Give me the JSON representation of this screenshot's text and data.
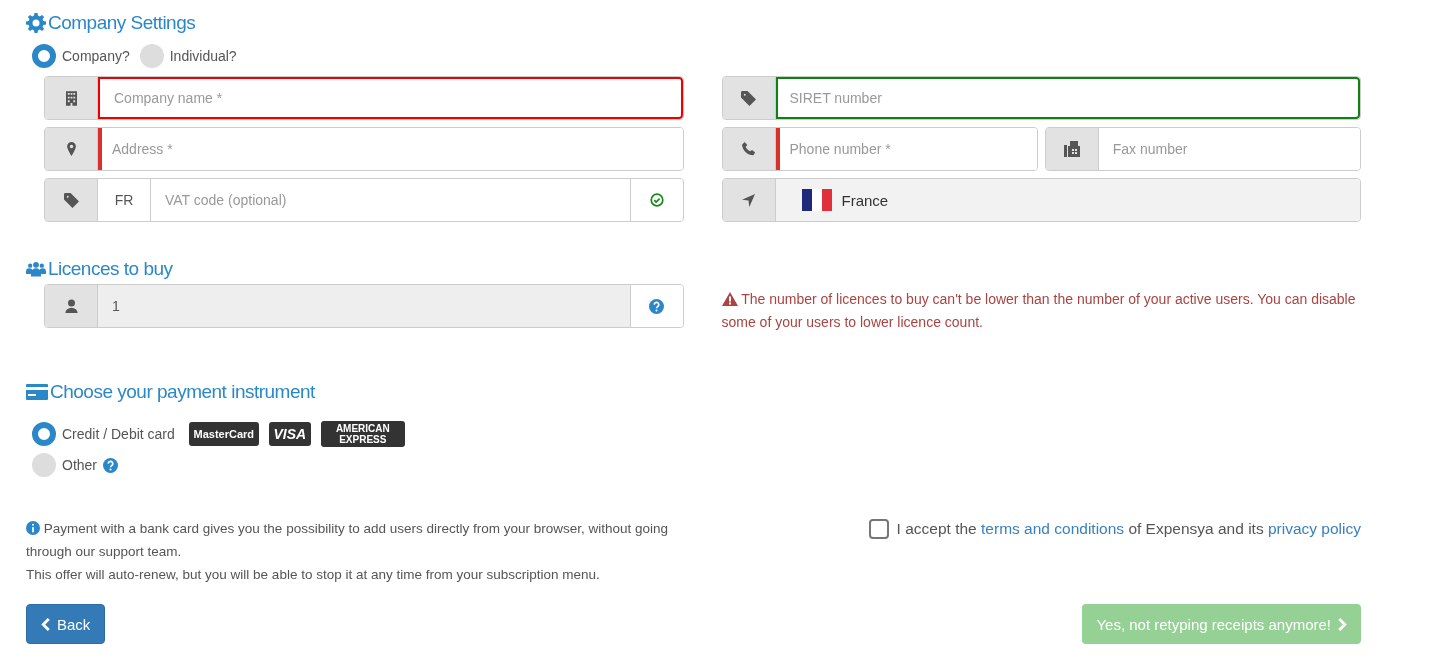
{
  "company_settings": {
    "title": "Company Settings",
    "entity_types": [
      {
        "label": "Company?",
        "selected": true
      },
      {
        "label": "Individual?",
        "selected": false
      }
    ],
    "left_fields": [
      {
        "kind": "input",
        "placeholder": "Company name *",
        "error": true,
        "required": false,
        "focused": false
      },
      {
        "kind": "input",
        "placeholder": "Address *",
        "error": false,
        "required": true,
        "focused": false
      },
      {
        "kind": "input",
        "placeholder": "VAT code (optional)",
        "error": false,
        "required": false,
        "focused": false,
        "prefix": "FR",
        "valid": true
      }
    ],
    "right_rows": [
      [
        {
          "kind": "input",
          "placeholder": "SIRET number",
          "error": false,
          "required": false,
          "focused": true
        }
      ],
      [
        {
          "kind": "input",
          "placeholder": "Phone number *",
          "error": false,
          "required": true,
          "focused": false
        },
        {
          "kind": "input",
          "placeholder": "Fax number",
          "error": false,
          "required": false,
          "focused": false
        }
      ],
      [
        {
          "kind": "country",
          "value": "France"
        }
      ]
    ]
  },
  "licences": {
    "title": "Licences to buy",
    "value": "1",
    "disabled": true,
    "warning": "The number of licences to buy can't be lower than the number of your active users. You can disable some of your users to lower licence count."
  },
  "payment": {
    "title": "Choose your payment instrument",
    "options": [
      {
        "label": "Credit / Debit card",
        "selected": true,
        "cards": [
          "MasterCard",
          "VISA",
          "AMERICAN EXPRESS"
        ]
      },
      {
        "label": "Other",
        "selected": false,
        "help": true
      }
    ]
  },
  "note": [
    "Payment with a bank card gives you the possibility to add users directly from your browser, without going through our support team.",
    "This offer will auto-renew, but you will be able to stop it at any time from your subscription menu."
  ],
  "terms": {
    "checked": false,
    "before": "I accept the",
    "link1": "terms and conditions",
    "middle": "of Expensya and its",
    "link2": "privacy policy"
  },
  "buttons": {
    "back": "Back",
    "submit": {
      "label": "Yes, not retyping receipts anymore!",
      "disabled": true
    }
  }
}
